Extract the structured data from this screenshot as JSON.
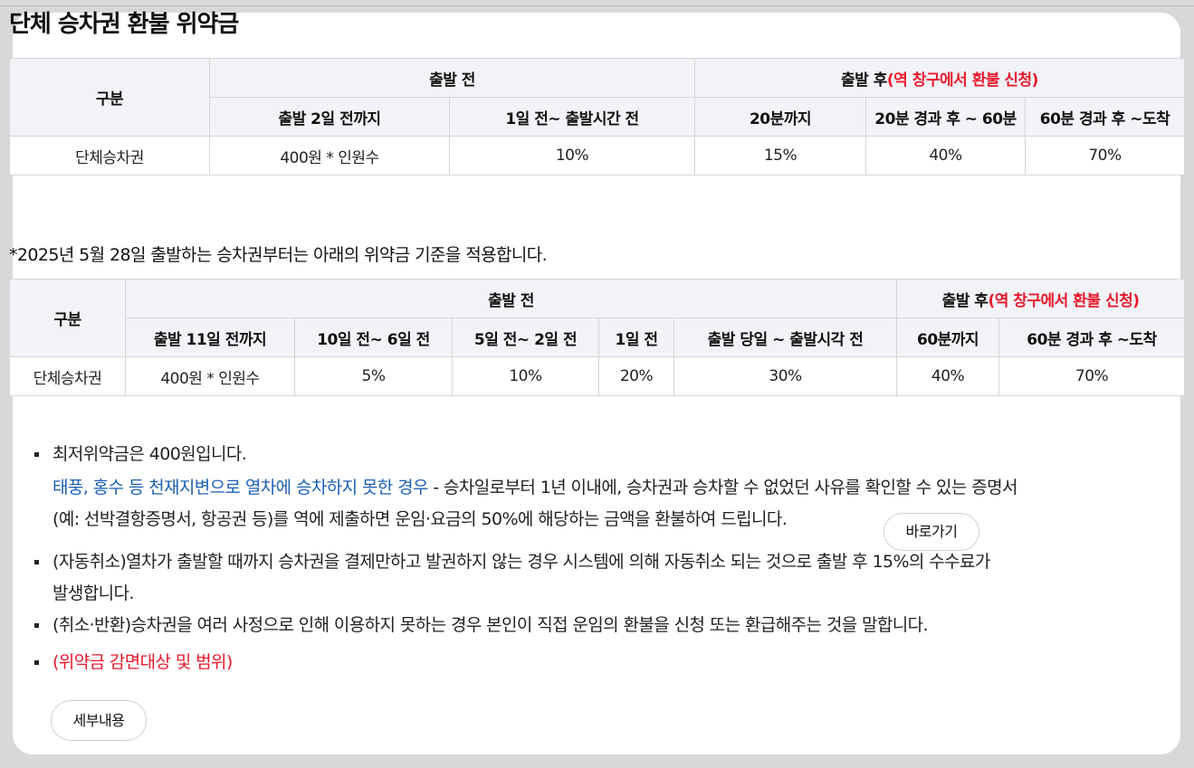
{
  "page_title": "단체 승차권 환불 위약금",
  "table1": {
    "category_header": "구분",
    "before_header": "출발 전",
    "after_header": "출발 후",
    "after_note": "(역 창구에서 환불 신청)",
    "sub_headers": [
      "출발 2일 전까지",
      "1일 전~ 출발시간 전",
      "20분까지",
      "20분 경과 후 ~ 60분",
      "60분 경과 후 ~도착"
    ],
    "row_label": "단체승차권",
    "row_values": [
      "400원 * 인원수",
      "10%",
      "15%",
      "40%",
      "70%"
    ]
  },
  "notice": "*2025년 5월 28일 출발하는 승차권부터는 아래의 위약금 기준을 적용합니다.",
  "table2": {
    "category_header": "구분",
    "before_header": "출발 전",
    "after_header": "출발 후",
    "after_note": "(역 창구에서 환불 신청)",
    "sub_headers": [
      "출발 11일 전까지",
      "10일 전~ 6일 전",
      "5일 전~ 2일 전",
      "1일 전",
      "출발 당일 ~ 출발시각 전",
      "60분까지",
      "60분 경과 후 ~도착"
    ],
    "row_label": "단체승차권",
    "row_values": [
      "400원 * 인원수",
      "5%",
      "10%",
      "20%",
      "30%",
      "40%",
      "70%"
    ]
  },
  "bullets": {
    "min_fee": "최저위약금은 400원입니다.",
    "disaster_title": "태풍, 홍수 등 천재지변으로 열차에 승차하지 못한 경우",
    "disaster_line1": " - 승차일로부터 1년 이내에, 승차권과 승차할 수 없었던 사유를 확인할 수 있는 증명서",
    "disaster_line2": "(예: 선박결항증명서, 항공권 등)를 역에 제출하면 운임·요금의 50%에 해당하는 금액을 환불하여 드립니다.",
    "goto_label": "바로가기",
    "auto_cancel_line1": "(자동취소)열차가 출발할 때까지 승차권을 결제만하고 발권하지 않는 경우 시스템에 의해 자동취소 되는 것으로 출발 후 15%의 수수료가",
    "auto_cancel_line2": "발생합니다.",
    "refund": "(취소·반환)승차권을 여러 사정으로 인해 이용하지 못하는 경우 본인이 직접 운임의 환불을 신청 또는 환급해주는 것을 말합니다.",
    "reduction": "(위약금 감면대상 및 범위)",
    "detail_label": "세부내용"
  },
  "colors": {
    "accent_red": "#e8182b",
    "link_blue": "#1c5fb3",
    "header_bg": "#f2f3f7"
  }
}
